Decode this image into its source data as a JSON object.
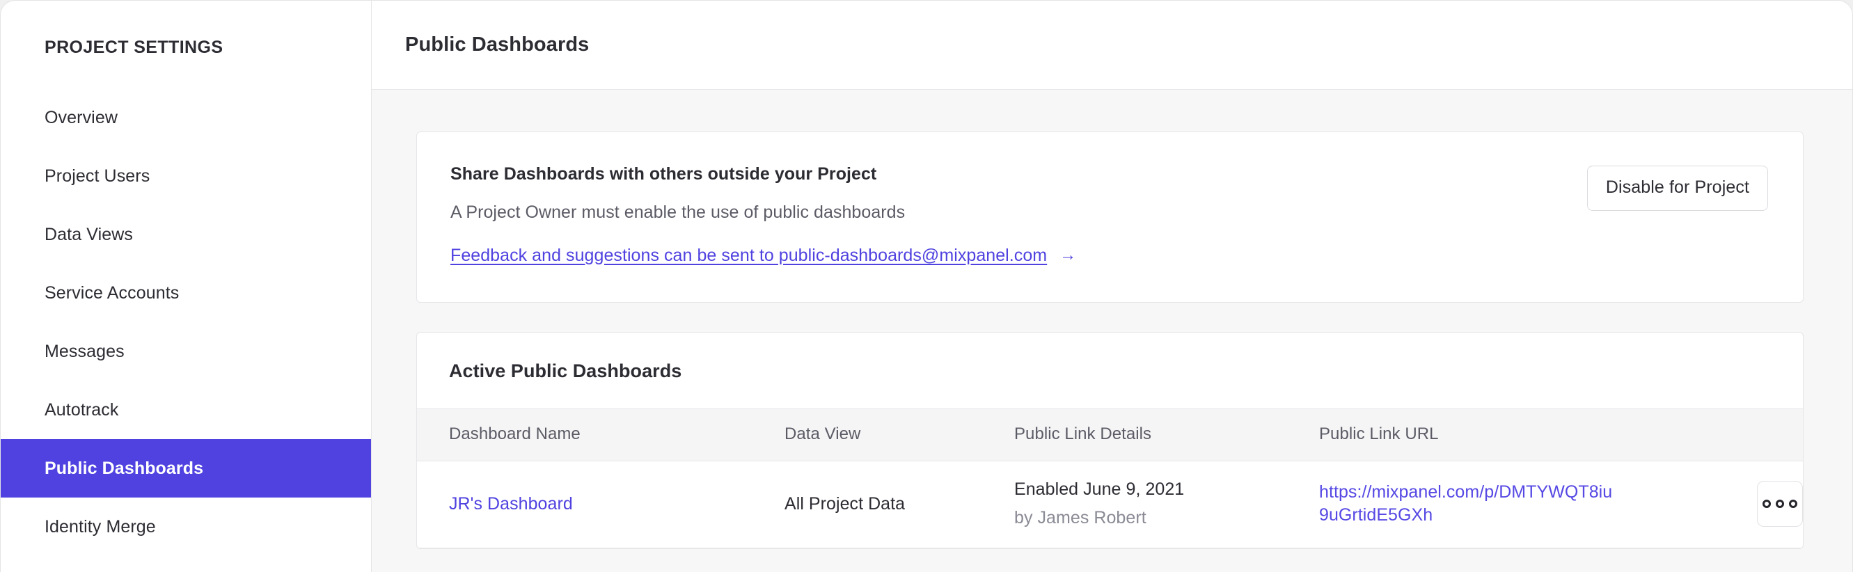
{
  "sidebar": {
    "title": "PROJECT SETTINGS",
    "items": [
      {
        "label": "Overview",
        "active": false
      },
      {
        "label": "Project Users",
        "active": false
      },
      {
        "label": "Data Views",
        "active": false
      },
      {
        "label": "Service Accounts",
        "active": false
      },
      {
        "label": "Messages",
        "active": false
      },
      {
        "label": "Autotrack",
        "active": false
      },
      {
        "label": "Public Dashboards",
        "active": true
      },
      {
        "label": "Identity Merge",
        "active": false
      }
    ]
  },
  "header": {
    "title": "Public Dashboards"
  },
  "share_card": {
    "heading": "Share Dashboards with others outside your Project",
    "subtext": "A Project Owner must enable the use of public dashboards",
    "feedback_link": "Feedback and suggestions can be sent to public-dashboards@mixpanel.com",
    "feedback_arrow": "→",
    "disable_button": "Disable for Project"
  },
  "table_card": {
    "title": "Active Public Dashboards",
    "columns": [
      "Dashboard Name",
      "Data View",
      "Public Link Details",
      "Public Link URL"
    ],
    "rows": [
      {
        "dashboard_name": "JR's Dashboard",
        "data_view": "All Project Data",
        "link_enabled": "Enabled June 9, 2021",
        "link_author": "by James Robert",
        "public_url": "https://mixpanel.com/p/DMTYWQT8iu9uGrtidE5GXh"
      }
    ]
  },
  "colors": {
    "accent": "#4f42e0",
    "link": "#5649e4",
    "text": "#2c2c33",
    "muted": "#8a8a95",
    "panel_bg": "#f7f7f8"
  }
}
